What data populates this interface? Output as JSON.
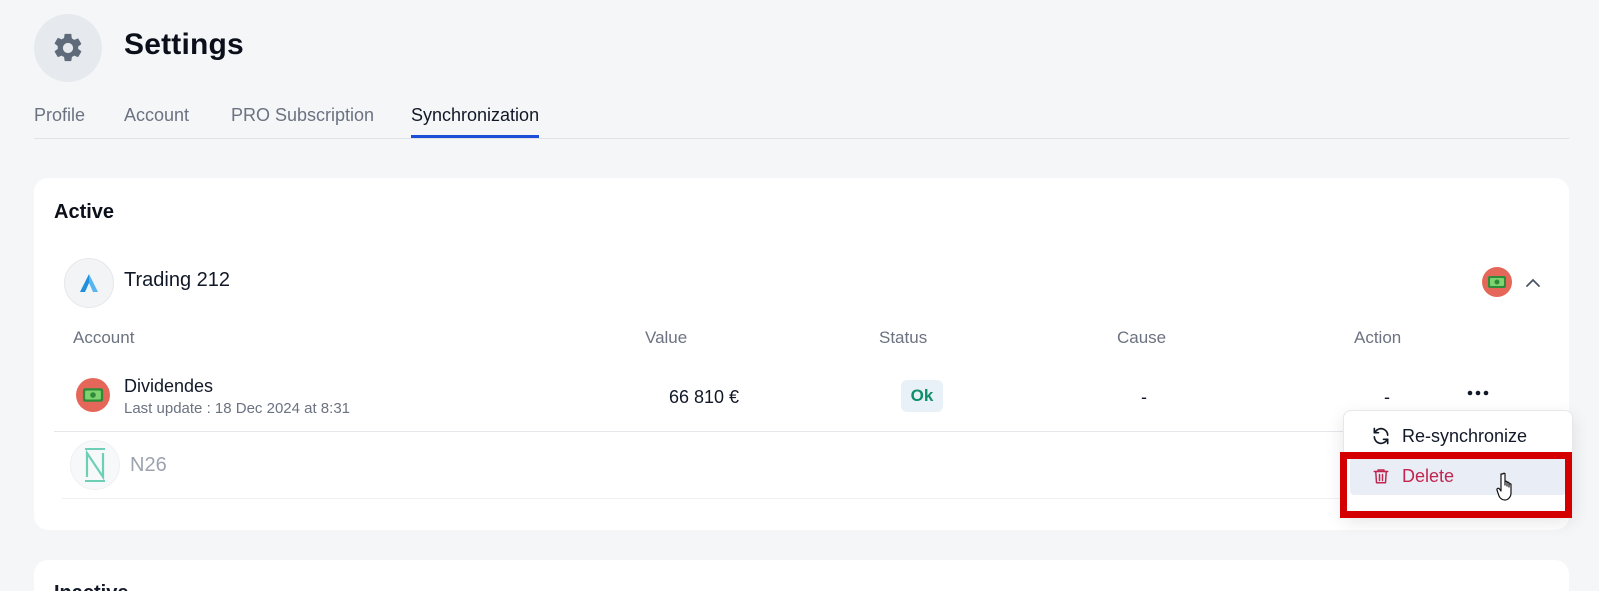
{
  "header": {
    "title": "Settings",
    "icon": "gear-icon"
  },
  "tabs": [
    {
      "label": "Profile",
      "active": false
    },
    {
      "label": "Account",
      "active": false
    },
    {
      "label": "PRO Subscription",
      "active": false
    },
    {
      "label": "Synchronization",
      "active": true
    }
  ],
  "active_section": {
    "title": "Active",
    "broker": {
      "name": "Trading 212",
      "logo": "trading212-logo"
    },
    "columns": [
      "Account",
      "Value",
      "Status",
      "Cause",
      "Action"
    ],
    "rows": [
      {
        "name": "Dividendes",
        "last_update": "Last update : 18 Dec 2024 at 8:31",
        "value": "66 810 €",
        "status": "Ok",
        "cause": "-",
        "action": "-"
      }
    ],
    "other_broker": {
      "name": "N26",
      "logo": "n26-logo"
    }
  },
  "menu": {
    "items": [
      {
        "label": "Re-synchronize",
        "icon": "refresh-icon"
      },
      {
        "label": "Delete",
        "icon": "trash-icon"
      }
    ]
  },
  "second_section": {
    "title": "Inactive"
  },
  "colors": {
    "accent": "#1d4ed8",
    "status_ok": "#0f8f68",
    "danger": "#c0264f",
    "highlight": "#d40000",
    "account_badge": "#e5675a"
  }
}
